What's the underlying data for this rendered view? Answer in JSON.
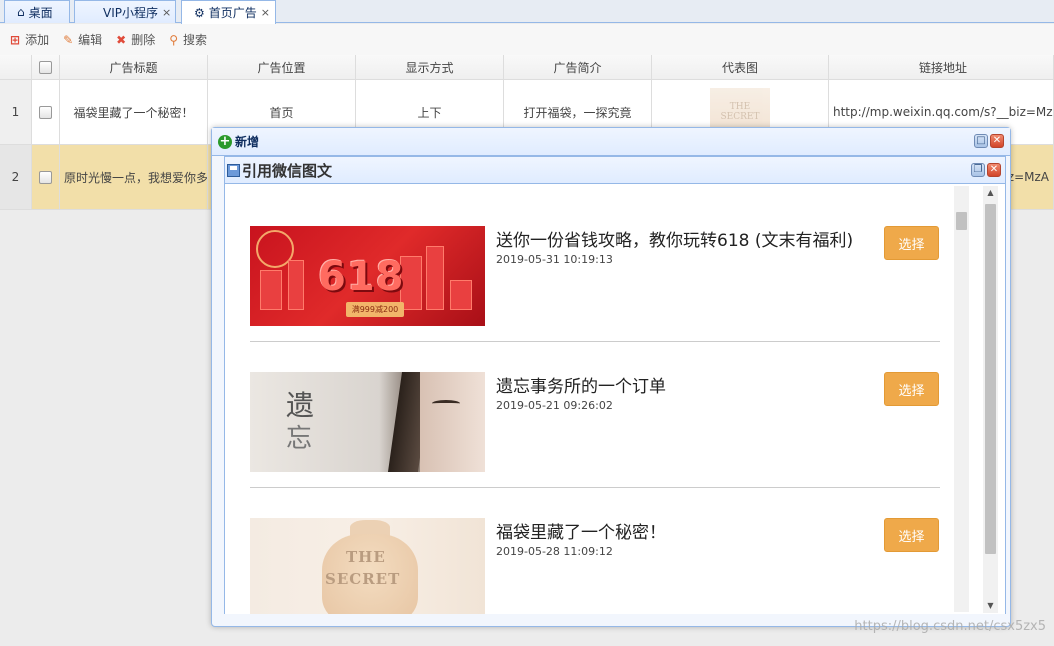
{
  "tabs": [
    {
      "label": "桌面",
      "icon": "home-icon",
      "closable": false
    },
    {
      "label": "VIP小程序",
      "icon": "",
      "closable": true
    },
    {
      "label": "首页广告",
      "icon": "gear-icon",
      "closable": true
    }
  ],
  "tab_close_glyph": "×",
  "toolbar": {
    "add_label": "添加",
    "edit_label": "编辑",
    "delete_label": "删除",
    "search_label": "搜索"
  },
  "grid": {
    "columns": [
      "广告标题",
      "广告位置",
      "显示方式",
      "广告简介",
      "代表图",
      "链接地址"
    ],
    "rows": [
      {
        "num": "1",
        "title": "福袋里藏了一个秘密！",
        "position": "首页",
        "mode": "上下",
        "desc": "打开福袋，一探究竟",
        "link": "http://mp.weixin.qq.com/s?__biz=MzA"
      },
      {
        "num": "2",
        "title": "原时光慢一点，我想爱你多",
        "position": "",
        "mode": "",
        "desc": "",
        "link": "biz=MzA"
      }
    ]
  },
  "outer_window": {
    "title": "新增"
  },
  "inner_window": {
    "title": "引用微信图文"
  },
  "articles": [
    {
      "title": "送你一份省钱攻略，教你玩转618 (文末有福利)",
      "date": "2019-05-31 10:19:13",
      "button": "选择",
      "thumb_text": "618",
      "thumb_sub": "满999减200"
    },
    {
      "title": "遗忘事务所的一个订单",
      "date": "2019-05-21 09:26:02",
      "button": "选择",
      "thumb_text": "遗",
      "thumb_sub": "忘"
    },
    {
      "title": "福袋里藏了一个秘密！",
      "date": "2019-05-28 11:09:12",
      "button": "选择",
      "thumb_text": "THE",
      "thumb_sub": "SECRET"
    }
  ],
  "watermark": "https://blog.csdn.net/csx5zx5",
  "colors": {
    "accent_button": "#efa94a",
    "selected_row": "#f2dfa9",
    "window_border": "#95b8e7"
  }
}
